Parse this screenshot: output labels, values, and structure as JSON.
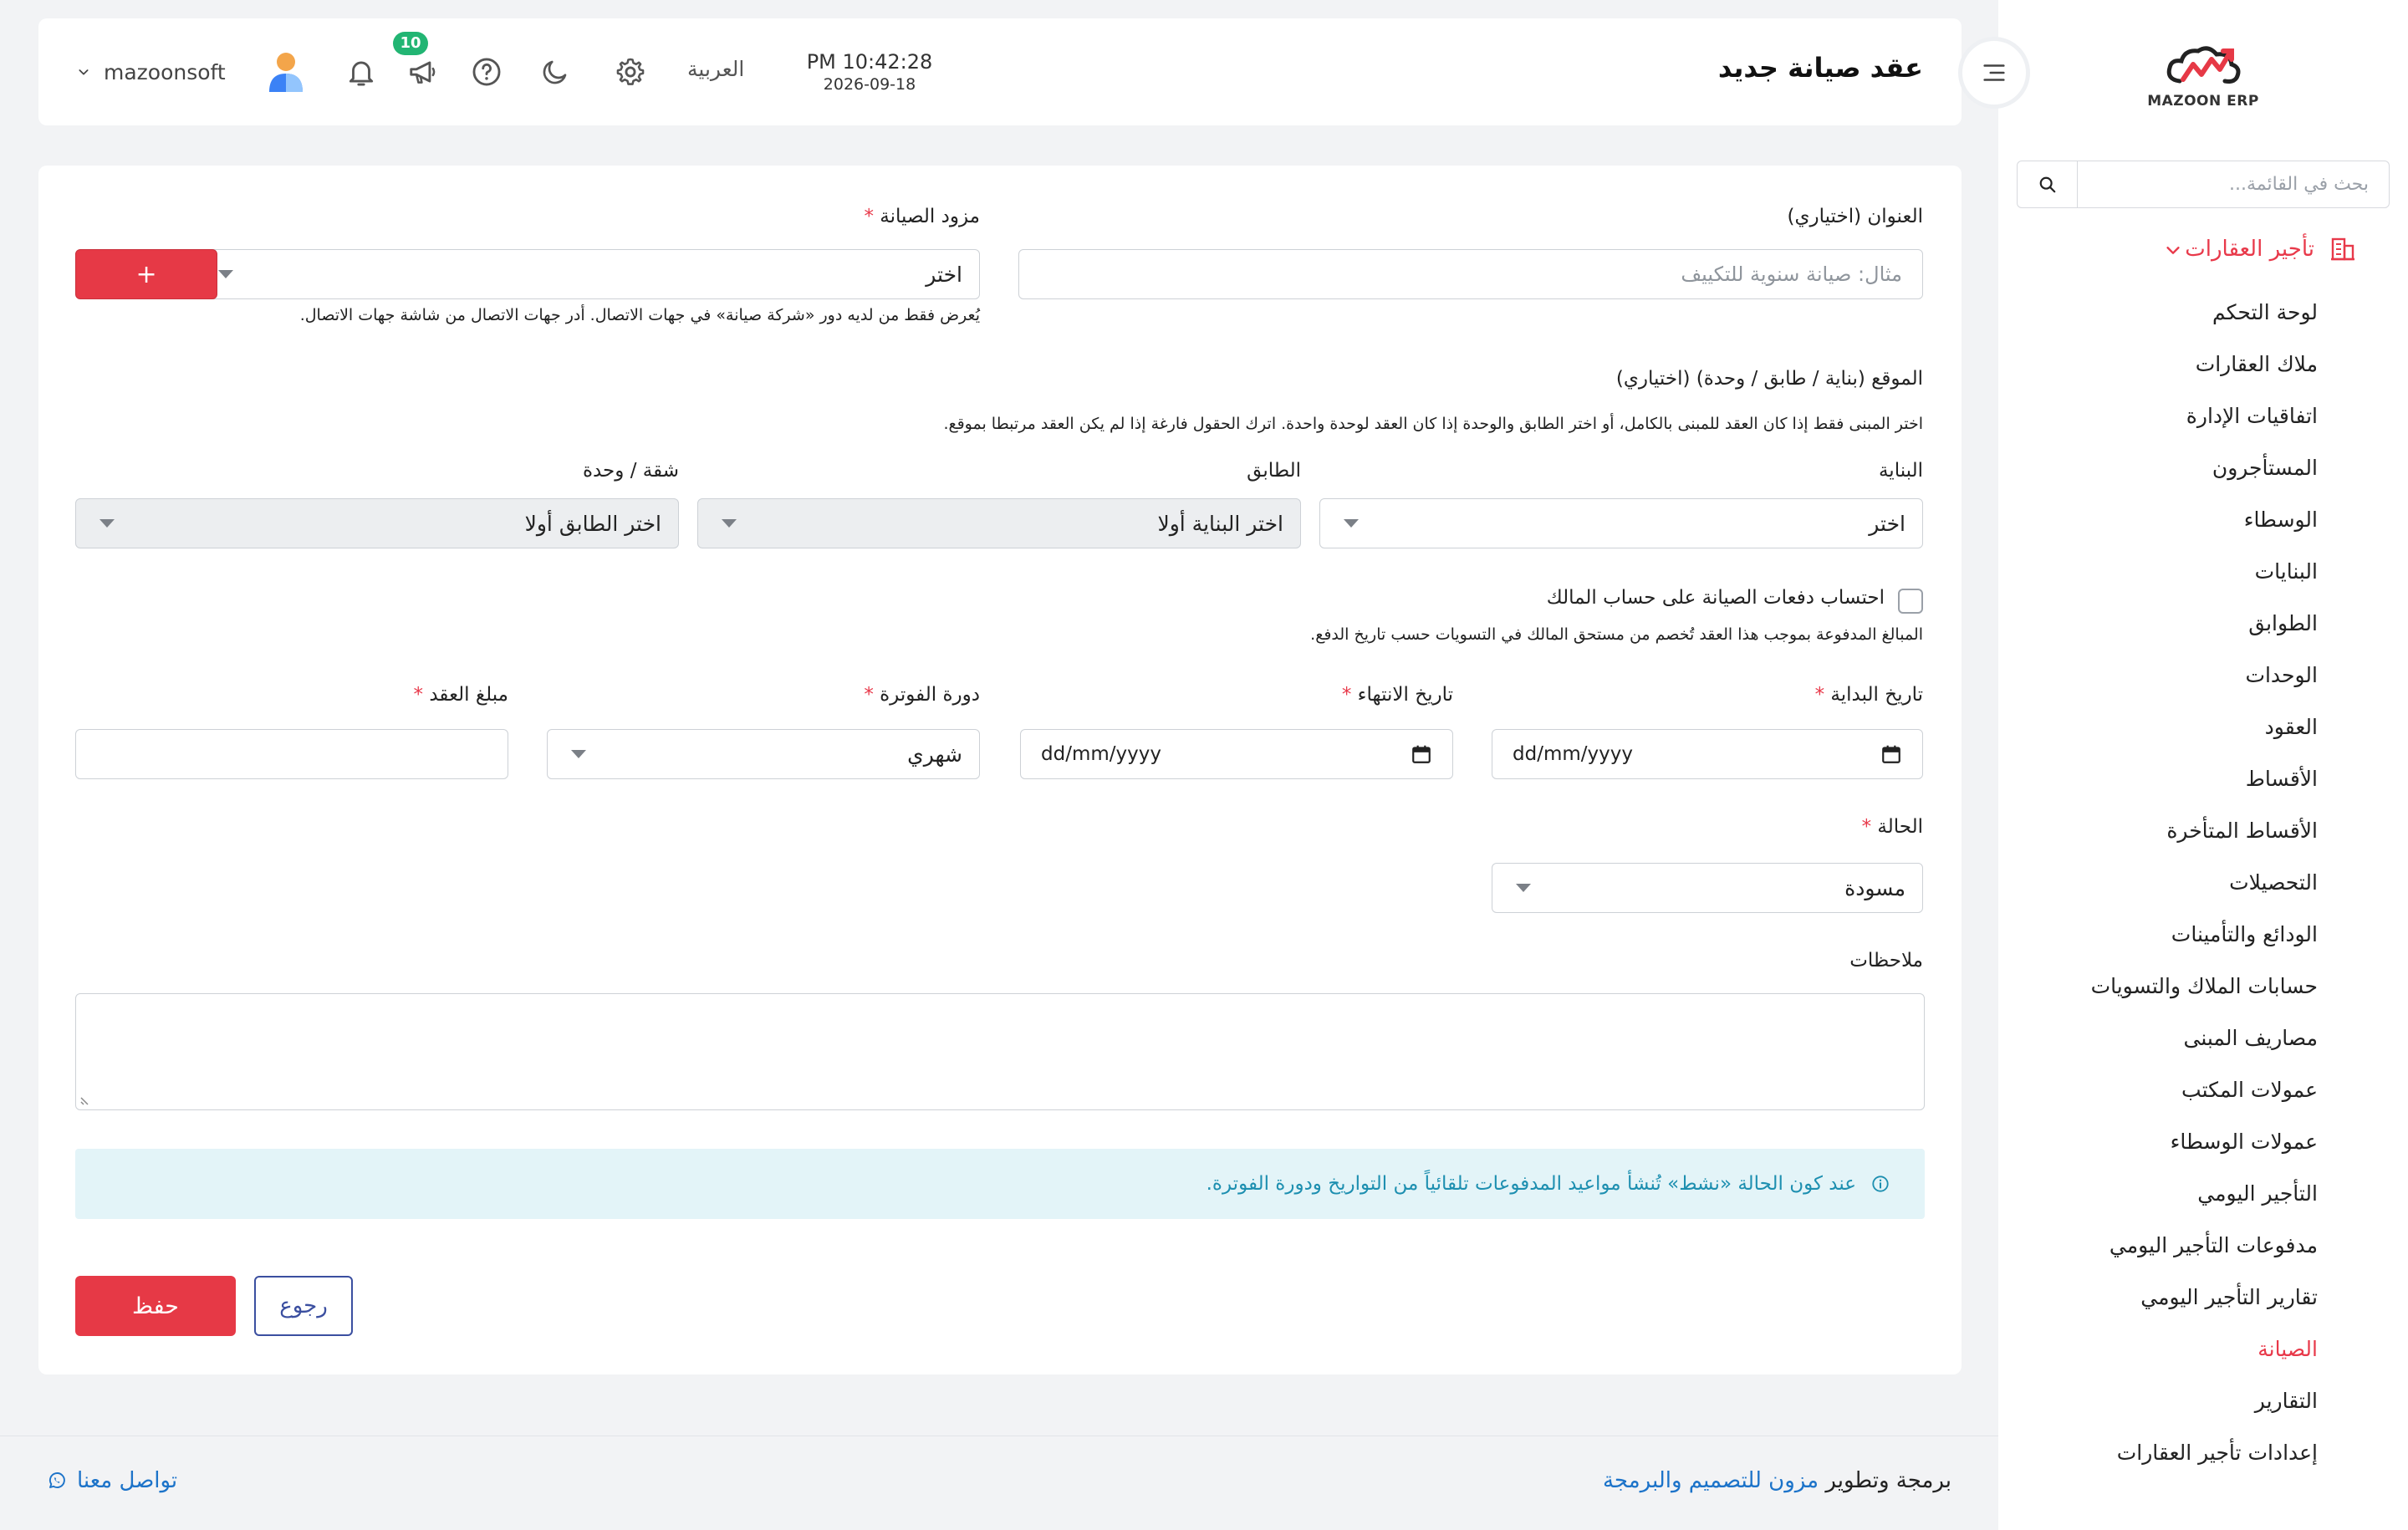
{
  "sidebar": {
    "logo_text": "MAZOON ERP",
    "search_placeholder": "بحث في القائمة...",
    "group_label": "تأجير العقارات",
    "items": [
      {
        "label": "لوحة التحكم"
      },
      {
        "label": "ملاك العقارات"
      },
      {
        "label": "اتفاقيات الإدارة"
      },
      {
        "label": "المستأجرون"
      },
      {
        "label": "الوسطاء"
      },
      {
        "label": "البنايات"
      },
      {
        "label": "الطوابق"
      },
      {
        "label": "الوحدات"
      },
      {
        "label": "العقود"
      },
      {
        "label": "الأقساط"
      },
      {
        "label": "الأقساط المتأخرة"
      },
      {
        "label": "التحصيلات"
      },
      {
        "label": "الودائع والتأمينات"
      },
      {
        "label": "حسابات الملاك والتسويات"
      },
      {
        "label": "مصاريف المبنى"
      },
      {
        "label": "عمولات المكتب"
      },
      {
        "label": "عمولات الوسطاء"
      },
      {
        "label": "التأجير اليومي"
      },
      {
        "label": "مدفوعات التأجير اليومي"
      },
      {
        "label": "تقارير التأجير اليومي"
      },
      {
        "label": "الصيانة"
      },
      {
        "label": "التقارير"
      },
      {
        "label": "إعدادات تأجير العقارات"
      }
    ]
  },
  "header": {
    "title": "عقد صيانة جديد",
    "time": "PM 10:42:28",
    "date": "2026-09-18",
    "language": "العربية",
    "notification_count": "10",
    "username": "mazoonsoft"
  },
  "form": {
    "title_label": "العنوان (اختياري)",
    "title_placeholder": "مثال: صيانة سنوية للتكييف",
    "provider_label": "مزود الصيانة",
    "provider_value": "اختر",
    "add_button": "+",
    "provider_hint": "يُعرض فقط من لديه دور «شركة صيانة» في جهات الاتصال. أدر جهات الاتصال من شاشة جهات الاتصال.",
    "location_label": "الموقع (بناية / طابق / وحدة) (اختياري)",
    "location_hint": "اختر المبنى فقط إذا كان العقد للمبنى بالكامل، أو اختر الطابق والوحدة إذا كان العقد لوحدة واحدة. اترك الحقول فارغة إذا لم يكن العقد مرتبطا بموقع.",
    "building_label": "البناية",
    "building_value": "اختر",
    "floor_label": "الطابق",
    "floor_value": "اختر البناية أولا",
    "unit_label": "شقة / وحدة",
    "unit_value": "اختر الطابق أولا",
    "owner_checkbox_label": "احتساب دفعات الصيانة على حساب المالك",
    "owner_checkbox_hint": "المبالغ المدفوعة بموجب هذا العقد تُخصم من مستحق المالك في التسويات حسب تاريخ الدفع.",
    "start_date_label": "تاريخ البداية",
    "start_date_value": "dd/mm/yyyy",
    "end_date_label": "تاريخ الانتهاء",
    "end_date_value": "dd/mm/yyyy",
    "billing_cycle_label": "دورة الفوترة",
    "billing_cycle_value": "شهري",
    "amount_label": "مبلغ العقد",
    "amount_value": "",
    "status_label": "الحالة",
    "status_value": "مسودة",
    "notes_label": "ملاحظات",
    "required_mark": "*",
    "info_text": "عند كون الحالة «نشط» تُنشأ مواعيد المدفوعات تلقائياً من التواريخ ودورة الفوترة.",
    "save_button": "حفظ",
    "back_button": "رجوع"
  },
  "footer": {
    "credit_prefix": "برمجة وتطوير",
    "credit_brand": "مزون للتصميم والبرمجة",
    "contact": "تواصل معنا"
  },
  "colors": {
    "accent": "#e63946",
    "info_bg": "#e3f4f8",
    "info_text": "#1d8fb0",
    "badge": "#22b573",
    "link": "#1c73c9"
  }
}
